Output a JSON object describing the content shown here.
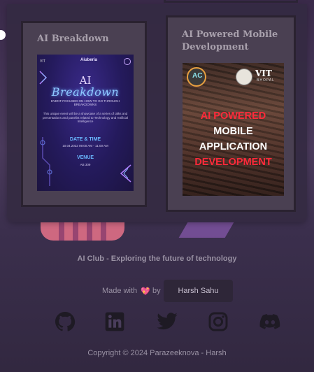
{
  "projects": [
    {
      "title": "AI Breakdown",
      "poster": {
        "header_left": "VIT",
        "header_mid": "Aiuberia",
        "title_line1": "AI",
        "title_line2": "Breakdown",
        "subtitle": "EVENT-FOCUSED ON HOW TO GO THROUGH BREAKDOWNS",
        "description": "This unique event will be a showcase of a series of talks and presentations and panelist related to Technology and Artificial Intelligence",
        "date_heading": "DATE & TIME",
        "date_value": "10.04.2022 09:00 AM - 11:00 AM",
        "venue_heading": "VENUE",
        "venue_value": "AB 309"
      }
    },
    {
      "title": "AI Powered Mobile Development",
      "poster": {
        "logo_text": "AC",
        "institute": "VIT",
        "campus": "BHOPAL",
        "line1": "AI POWERED",
        "line2": "MOBILE",
        "line3": "APPLICATION",
        "line4": "DEVELOPMENT"
      }
    }
  ],
  "footer": {
    "tagline": "AI Club - Exploring the future of technology",
    "made_with": "Made with",
    "heart": "💖",
    "by": "by",
    "author_button": "Harsh Sahu",
    "socials": [
      "github-icon",
      "linkedin-icon",
      "twitter-icon",
      "instagram-icon",
      "discord-icon"
    ],
    "copyright": "Copyright © 2024 Parazeeknova - Harsh"
  },
  "colors": {
    "background": "#3f3150",
    "card": "#4a4052",
    "card_border": "#2a2230",
    "text_muted": "#9a92a4",
    "accent_red": "#ff2a3a",
    "accent_blue": "#6ab8ff"
  }
}
